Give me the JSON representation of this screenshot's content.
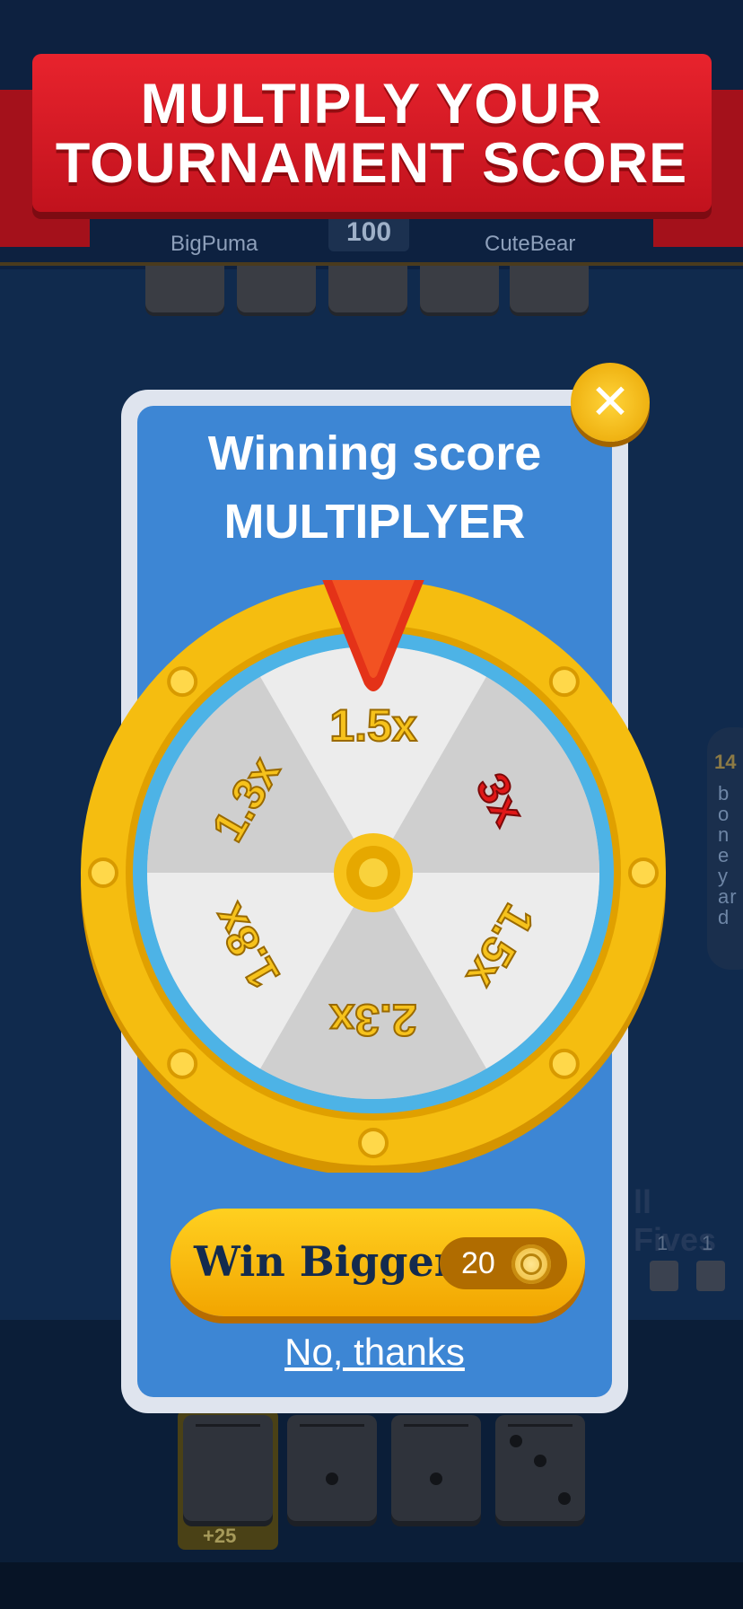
{
  "banner": {
    "line1": "MULTIPLY YOUR",
    "line2": "TOURNAMENT SCORE"
  },
  "background": {
    "player_left": "BigPuma",
    "player_right": "CuteBear",
    "score": "100",
    "boneyard_count": "14",
    "boneyard_label": "boneyard",
    "mode_label": "ll Fives",
    "mini_counts": [
      "1",
      "1"
    ],
    "hand_bonus": "+25"
  },
  "modal": {
    "title_line1": "Winning score",
    "title_line2": "MULTIPLYER",
    "close_icon": "close-icon",
    "wheel_segments": [
      "1.5x",
      "3x",
      "1.5x",
      "2.3x",
      "1.8x",
      "1.3x"
    ],
    "cta_label": "Win Bigger",
    "cta_price": "20",
    "cta_icon": "coin-icon",
    "decline_label": "No, thanks"
  },
  "colors": {
    "banner_red": "#d41a24",
    "modal_blue": "#3d86d4",
    "wheel_gold": "#f5b800",
    "wheel_rim": "#4db3e6",
    "segment_text": "#f6c21c",
    "highlight_text": "#e01818"
  }
}
